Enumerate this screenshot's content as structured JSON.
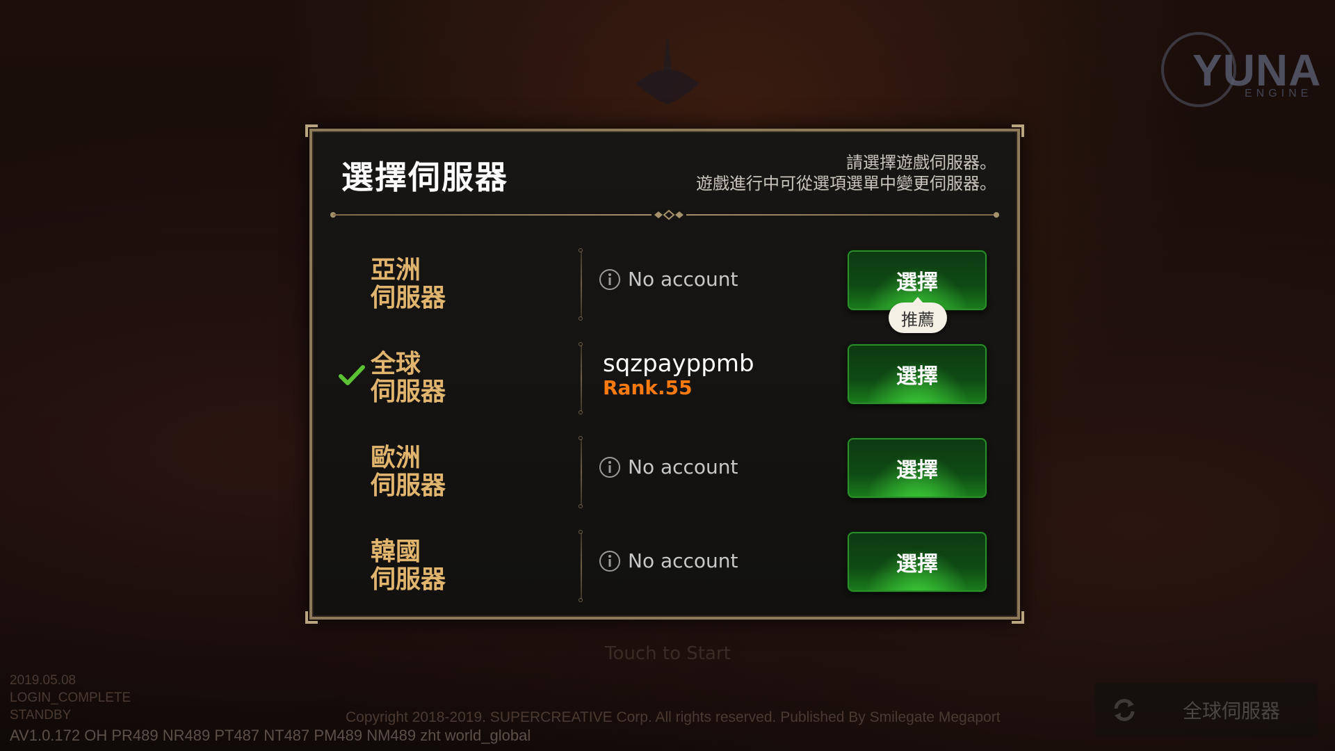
{
  "logo": {
    "text": "YUNA",
    "subtext": "ENGINE"
  },
  "dialog": {
    "title": "選擇伺服器",
    "hint_line1": "請選擇遊戲伺服器。",
    "hint_line2": "遊戲進行中可從選項選單中變更伺服器。",
    "servers": [
      {
        "name_line1": "亞洲",
        "name_line2": "伺服器",
        "status": "No account",
        "button": "選擇",
        "badge": "推薦"
      },
      {
        "name_line1": "全球",
        "name_line2": "伺服器",
        "username": "sqzpayppmb",
        "rank": "Rank.55",
        "button": "選擇",
        "selected": true
      },
      {
        "name_line1": "歐洲",
        "name_line2": "伺服器",
        "status": "No account",
        "button": "選擇"
      },
      {
        "name_line1": "韓國",
        "name_line2": "伺服器",
        "status": "No account",
        "button": "選擇"
      }
    ]
  },
  "footer": {
    "faint_center": "Touch to Start",
    "status_lines": [
      "2019.05.08",
      "LOGIN_COMPLETE",
      "STANDBY"
    ],
    "version": "AV1.0.172 OH PR489 NR489 PT487 NT487 PM489 NM489 zht world_global",
    "copyright": "Copyright 2018-2019. SUPERCREATIVE Corp. All rights reserved. Published By Smilegate Megaport",
    "current_server": "全球伺服器"
  },
  "colors": {
    "accent_gold": "#e2b56e",
    "rank_orange": "#ff7a0a",
    "button_green": "#1a7a1c",
    "check_green": "#5bc236"
  }
}
